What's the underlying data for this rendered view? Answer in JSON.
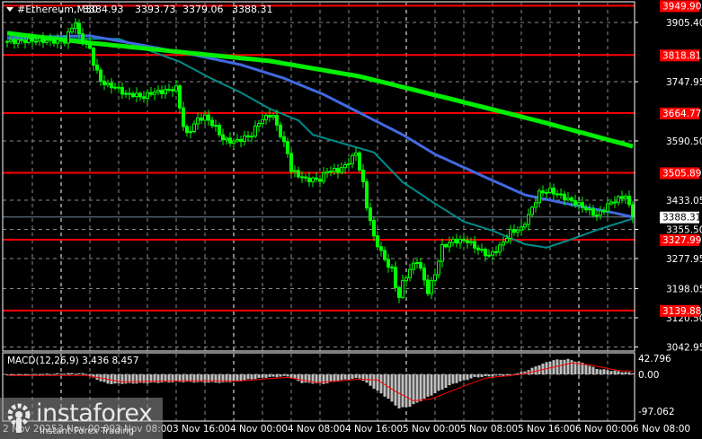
{
  "header": {
    "symbol": "#Ethereum,M30",
    "open": "3384.93",
    "high": "3393.73",
    "low": "3379.06",
    "close": "3388.31"
  },
  "colors": {
    "bg": "#000000",
    "candle": "#00ff00",
    "ma_slow": "#00ee00",
    "ma_mid": "#4169e1",
    "ma_fast": "#008b8b",
    "level": "#ff0000",
    "grid": "#8a8a8a",
    "macd_hist": "#c0c0c0",
    "macd_signal": "#ff0000"
  },
  "logo": {
    "brand": "instaforex",
    "tagline": "Instant Forex Trading"
  },
  "chart_data": [
    {
      "type": "candlestick",
      "title": "#Ethereum,M30",
      "bars": 175,
      "ylim": [
        3042.95,
        3949.9
      ],
      "y_ticks": [
        "3905.40",
        "3747.95",
        "3590.50",
        "3433.05",
        "3355.50",
        "3277.95",
        "3198.05",
        "3120.50",
        "3042.95"
      ],
      "y_tick_values": [
        3905.4,
        3747.95,
        3590.5,
        3433.05,
        3355.5,
        3277.95,
        3198.05,
        3120.5,
        3042.95
      ],
      "levels": [
        {
          "label": "3949.90",
          "value": 3949.9
        },
        {
          "label": "3818.81",
          "value": 3818.81
        },
        {
          "label": "3664.77",
          "value": 3664.77
        },
        {
          "label": "3505.89",
          "value": 3505.89
        },
        {
          "label": "3327.99",
          "value": 3327.99
        },
        {
          "label": "3139.88",
          "value": 3139.88
        }
      ],
      "current_price": {
        "label": "3388.31",
        "value": 3388.31
      },
      "x_labels": [
        {
          "label": "2 Nov 2025",
          "bar": -1
        },
        {
          "label": "3 Nov 00:00",
          "bar": 15
        },
        {
          "label": "3 Nov 08:00",
          "bar": 31
        },
        {
          "label": "3 Nov 16:00",
          "bar": 47
        },
        {
          "label": "4 Nov 00:00",
          "bar": 63
        },
        {
          "label": "4 Nov 08:00",
          "bar": 79
        },
        {
          "label": "4 Nov 16:00",
          "bar": 95
        },
        {
          "label": "5 Nov 00:00",
          "bar": 111
        },
        {
          "label": "5 Nov 08:00",
          "bar": 127
        },
        {
          "label": "5 Nov 16:00",
          "bar": 143
        },
        {
          "label": "6 Nov 00:00",
          "bar": 159
        },
        {
          "label": "6 Nov 08:00",
          "bar": 175
        }
      ],
      "close_path": [
        [
          0,
          3855
        ],
        [
          8,
          3858
        ],
        [
          16,
          3855
        ],
        [
          18,
          3893
        ],
        [
          19,
          3905
        ],
        [
          20,
          3870
        ],
        [
          22,
          3850
        ],
        [
          23,
          3834
        ],
        [
          24,
          3798
        ],
        [
          26,
          3750
        ],
        [
          28,
          3738
        ],
        [
          30,
          3734
        ],
        [
          33,
          3714
        ],
        [
          35,
          3714
        ],
        [
          38,
          3707
        ],
        [
          40,
          3719
        ],
        [
          43,
          3722
        ],
        [
          45,
          3726
        ],
        [
          47,
          3731
        ],
        [
          49,
          3631
        ],
        [
          50,
          3607
        ],
        [
          53,
          3648
        ],
        [
          55,
          3655
        ],
        [
          58,
          3626
        ],
        [
          60,
          3595
        ],
        [
          63,
          3588
        ],
        [
          65,
          3595
        ],
        [
          68,
          3607
        ],
        [
          70,
          3641
        ],
        [
          73,
          3660
        ],
        [
          74,
          3655
        ],
        [
          76,
          3607
        ],
        [
          78,
          3559
        ],
        [
          79,
          3512
        ],
        [
          81,
          3500
        ],
        [
          83,
          3488
        ],
        [
          87,
          3488
        ],
        [
          89,
          3512
        ],
        [
          92,
          3512
        ],
        [
          94,
          3524
        ],
        [
          97,
          3559
        ],
        [
          99,
          3476
        ],
        [
          100,
          3416
        ],
        [
          101,
          3380
        ],
        [
          102,
          3333
        ],
        [
          104,
          3297
        ],
        [
          105,
          3273
        ],
        [
          107,
          3249
        ],
        [
          108,
          3202
        ],
        [
          109,
          3178
        ],
        [
          110,
          3213
        ],
        [
          112,
          3249
        ],
        [
          114,
          3273
        ],
        [
          115,
          3249
        ],
        [
          117,
          3190
        ],
        [
          119,
          3237
        ],
        [
          121,
          3309
        ],
        [
          124,
          3325
        ],
        [
          128,
          3325
        ],
        [
          130,
          3309
        ],
        [
          134,
          3285
        ],
        [
          137,
          3309
        ],
        [
          140,
          3349
        ],
        [
          143,
          3357
        ],
        [
          145,
          3392
        ],
        [
          148,
          3452
        ],
        [
          151,
          3459
        ],
        [
          155,
          3440
        ],
        [
          160,
          3416
        ],
        [
          164,
          3392
        ],
        [
          168,
          3428
        ],
        [
          172,
          3445
        ],
        [
          173,
          3416
        ],
        [
          174,
          3388
        ]
      ],
      "ma_slow": [
        [
          0,
          3877
        ],
        [
          23,
          3851
        ],
        [
          48,
          3827
        ],
        [
          73,
          3803
        ],
        [
          98,
          3762
        ],
        [
          123,
          3703
        ],
        [
          148,
          3643
        ],
        [
          174,
          3576
        ]
      ],
      "ma_mid": [
        [
          0,
          3865
        ],
        [
          23,
          3870
        ],
        [
          48,
          3827
        ],
        [
          65,
          3793
        ],
        [
          77,
          3757
        ],
        [
          88,
          3714
        ],
        [
          110,
          3607
        ],
        [
          119,
          3555
        ],
        [
          130,
          3507
        ],
        [
          144,
          3447
        ],
        [
          156,
          3423
        ],
        [
          169,
          3399
        ],
        [
          174,
          3388
        ]
      ],
      "ma_fast": [
        [
          0,
          3862
        ],
        [
          31,
          3862
        ],
        [
          40,
          3829
        ],
        [
          48,
          3801
        ],
        [
          56,
          3760
        ],
        [
          65,
          3719
        ],
        [
          73,
          3676
        ],
        [
          81,
          3645
        ],
        [
          85,
          3607
        ],
        [
          102,
          3560
        ],
        [
          110,
          3481
        ],
        [
          119,
          3424
        ],
        [
          127,
          3376
        ],
        [
          135,
          3352
        ],
        [
          144,
          3316
        ],
        [
          150,
          3307
        ],
        [
          156,
          3326
        ],
        [
          165,
          3357
        ],
        [
          174,
          3384
        ]
      ]
    },
    {
      "type": "bar",
      "title": "MACD(12,26,9)",
      "label": "MACD(12,26,9) 3.436 8.457",
      "macd": 3.436,
      "signal_value": 8.457,
      "ylim": [
        -97.062,
        42.796
      ],
      "y_ticks": [
        "42.796",
        "0.00",
        "-97.062"
      ],
      "y_tick_values": [
        42.796,
        0,
        -97.062
      ],
      "histogram": [
        [
          0,
          -2
        ],
        [
          18,
          3
        ],
        [
          22,
          2
        ],
        [
          24,
          -10
        ],
        [
          28,
          -25
        ],
        [
          35,
          -24
        ],
        [
          48,
          -20
        ],
        [
          60,
          -22
        ],
        [
          66,
          -15
        ],
        [
          72,
          -8
        ],
        [
          78,
          -5
        ],
        [
          82,
          -22
        ],
        [
          88,
          -25
        ],
        [
          94,
          -14
        ],
        [
          98,
          -10
        ],
        [
          101,
          -30
        ],
        [
          106,
          -65
        ],
        [
          109,
          -90
        ],
        [
          112,
          -85
        ],
        [
          118,
          -55
        ],
        [
          124,
          -25
        ],
        [
          130,
          -8
        ],
        [
          136,
          -4
        ],
        [
          140,
          -2
        ],
        [
          144,
          8
        ],
        [
          148,
          25
        ],
        [
          152,
          38
        ],
        [
          156,
          40
        ],
        [
          160,
          30
        ],
        [
          164,
          15
        ],
        [
          168,
          10
        ],
        [
          172,
          6
        ],
        [
          174,
          3.4
        ]
      ],
      "signal": [
        [
          0,
          -3
        ],
        [
          22,
          -3
        ],
        [
          32,
          -20
        ],
        [
          42,
          -18
        ],
        [
          55,
          -17
        ],
        [
          64,
          -18
        ],
        [
          72,
          -12
        ],
        [
          78,
          -8
        ],
        [
          86,
          -22
        ],
        [
          98,
          -13
        ],
        [
          103,
          -15
        ],
        [
          108,
          -45
        ],
        [
          113,
          -70
        ],
        [
          118,
          -65
        ],
        [
          126,
          -35
        ],
        [
          133,
          -10
        ],
        [
          143,
          0
        ],
        [
          150,
          15
        ],
        [
          157,
          30
        ],
        [
          162,
          25
        ],
        [
          170,
          10
        ],
        [
          174,
          8.457
        ]
      ]
    }
  ]
}
